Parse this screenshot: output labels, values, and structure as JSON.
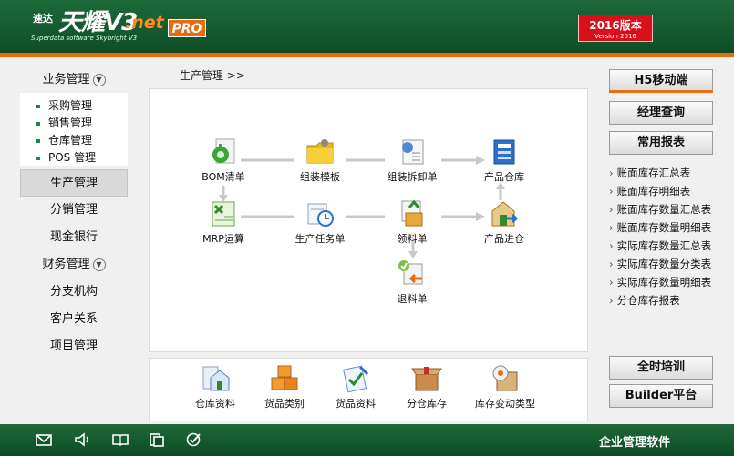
{
  "brand": {
    "small": "速达",
    "main": "天耀V3",
    "net": ".net",
    "pro": "PRO",
    "subtitle": "Superdata software Skybright V3",
    "version_main": "2016版本",
    "version_sub": "Version 2016"
  },
  "sidebar": {
    "business_mgmt": "业务管理",
    "business_sub": [
      "采购管理",
      "销售管理",
      "仓库管理",
      "POS 管理"
    ],
    "production_mgmt": "生产管理",
    "distribution_mgmt": "分销管理",
    "cash_bank": "现金银行",
    "finance_mgmt": "财务管理",
    "branch": "分支机构",
    "customer": "客户关系",
    "project": "项目管理"
  },
  "breadcrumb": "生产管理 >>",
  "flow": {
    "bom": "BOM清单",
    "assembly_template": "组装模板",
    "assembly_order": "组装拆卸单",
    "product_warehouse": "产品仓库",
    "mrp": "MRP运算",
    "production_task": "生产任务单",
    "material_pick": "领料单",
    "product_in": "产品进仓",
    "material_return": "退料单"
  },
  "bottom": {
    "warehouse_data": "仓库资料",
    "goods_category": "货品类别",
    "goods_data": "货品资料",
    "branch_stock": "分仓库存",
    "stock_change_type": "库存变动类型"
  },
  "right": {
    "h5": "H5移动端",
    "manager_query": "经理查询",
    "common_reports": "常用报表",
    "reports": [
      "账面库存汇总表",
      "账面库存明细表",
      "账面库存数量汇总表",
      "账面库存数量明细表",
      "实际库存数量汇总表",
      "实际库存数量分类表",
      "实际库存数量明细表",
      "分仓库存报表"
    ],
    "training": "全时培训",
    "builder": "Builder平台"
  },
  "footer": {
    "title": "企业管理软件"
  },
  "colors": {
    "header_green": "#1f6a3a",
    "accent_orange": "#e86b10",
    "badge_red": "#d8101a"
  }
}
